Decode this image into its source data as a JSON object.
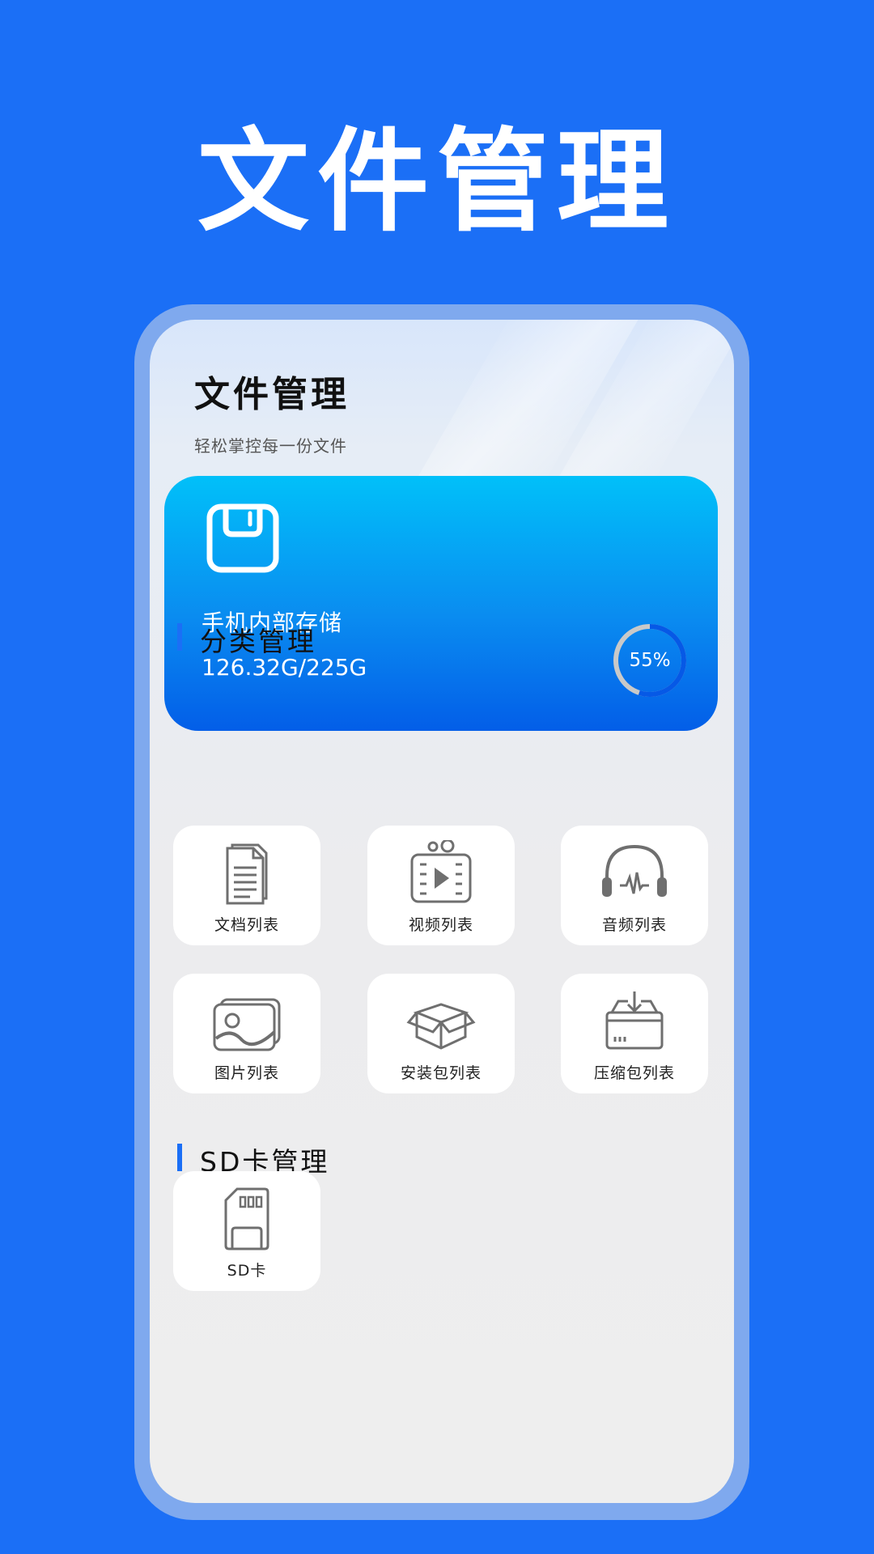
{
  "promo": {
    "title": "文件管理"
  },
  "app": {
    "title": "文件管理",
    "subtitle": "轻松掌控每一份文件"
  },
  "storage": {
    "label": "手机内部存储",
    "usage": "126.32G/225G",
    "percent_label": "55%",
    "percent": 0.55
  },
  "sections": {
    "category": {
      "title": "分类管理",
      "items": [
        {
          "label": "文档列表",
          "icon": "document-icon"
        },
        {
          "label": "视频列表",
          "icon": "video-icon"
        },
        {
          "label": "音频列表",
          "icon": "headphones-icon"
        },
        {
          "label": "图片列表",
          "icon": "image-icon"
        },
        {
          "label": "安装包列表",
          "icon": "package-box-icon"
        },
        {
          "label": "压缩包列表",
          "icon": "archive-download-icon"
        }
      ]
    },
    "sd": {
      "title": "SD卡管理",
      "items": [
        {
          "label": "SD卡",
          "icon": "sd-card-icon"
        }
      ]
    }
  },
  "colors": {
    "background": "#1b6ff6",
    "frame": "#7fa9ee",
    "card_top": "#01c0f9",
    "card_bottom": "#035ee8",
    "accent_bar": "#1b6ff6",
    "icon_gray": "#6f6f6f"
  }
}
